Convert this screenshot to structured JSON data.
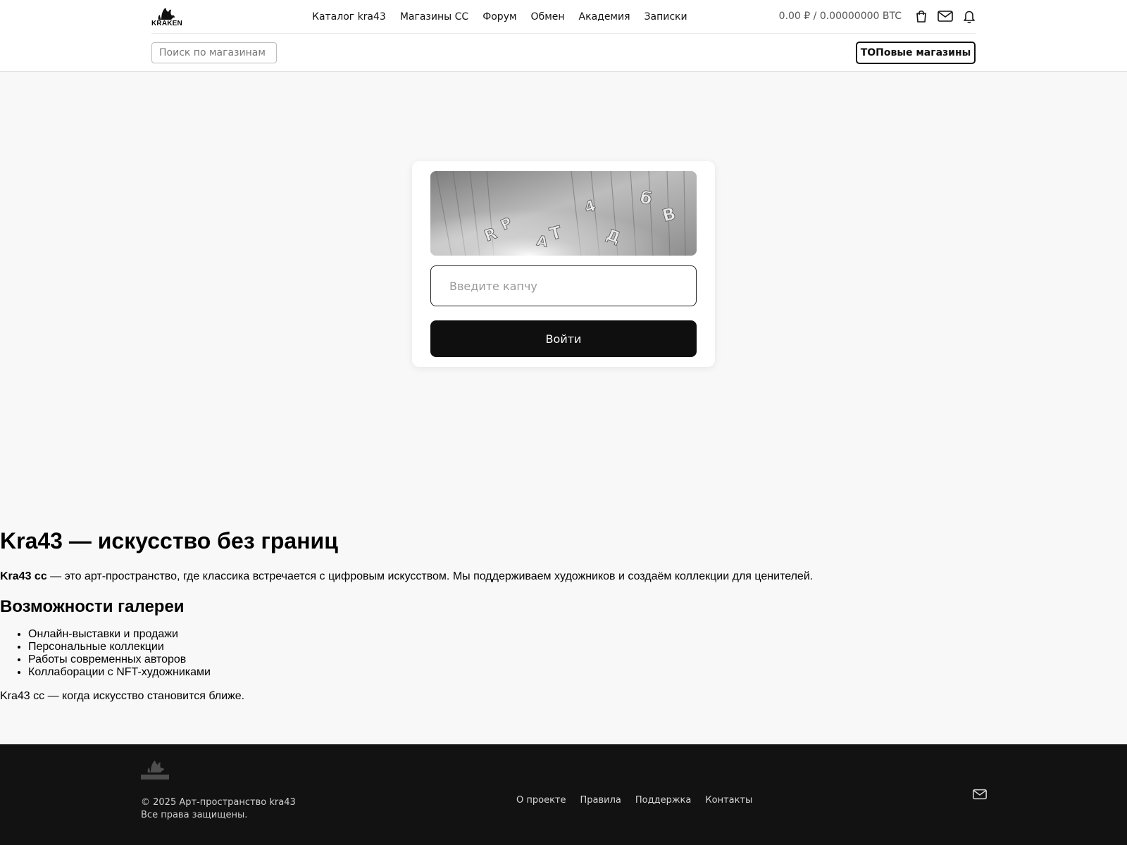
{
  "header": {
    "logo_text": "KRAKEN",
    "nav": [
      {
        "label": "Каталог kra43"
      },
      {
        "label": "Магазины СС"
      },
      {
        "label": "Форум"
      },
      {
        "label": "Обмен"
      },
      {
        "label": "Академия"
      },
      {
        "label": "Записки"
      }
    ],
    "balance": "0.00 ₽ / 0.00000000 BTC",
    "icons": [
      "shopping-bag-icon",
      "mail-icon",
      "bell-icon"
    ],
    "search_placeholder": "Поиск по магазинам",
    "top_shops_label": "ТОПовые магазины"
  },
  "captcha": {
    "input_placeholder": "Введите капчу",
    "submit_label": "Войти"
  },
  "content": {
    "title": "Kra43 — искусство без границ",
    "intro_bold": "Kra43 cc",
    "intro_rest": " — это арт-пространство, где классика встречается с цифровым искусством. Мы поддерживаем художников и создаём коллекции для ценителей.",
    "features_title": "Возможности галереи",
    "features": [
      "Онлайн-выставки и продажи",
      "Персональные коллекции",
      "Работы современных авторов",
      "Коллаборации с NFT-художниками"
    ],
    "closing": "Kra43 cc — когда искусство становится ближе."
  },
  "footer": {
    "copyright_line1": "© 2025 Арт-пространство kra43",
    "copyright_line2": "Все права защищены.",
    "links": [
      {
        "label": "О проекте"
      },
      {
        "label": "Правила"
      },
      {
        "label": "Поддержка"
      },
      {
        "label": "Контакты"
      }
    ]
  },
  "colors": {
    "header_bg": "#ffffff",
    "page_bg": "#f8f8f8",
    "button_dark": "#0f0f0f",
    "footer_bg": "#121212"
  }
}
